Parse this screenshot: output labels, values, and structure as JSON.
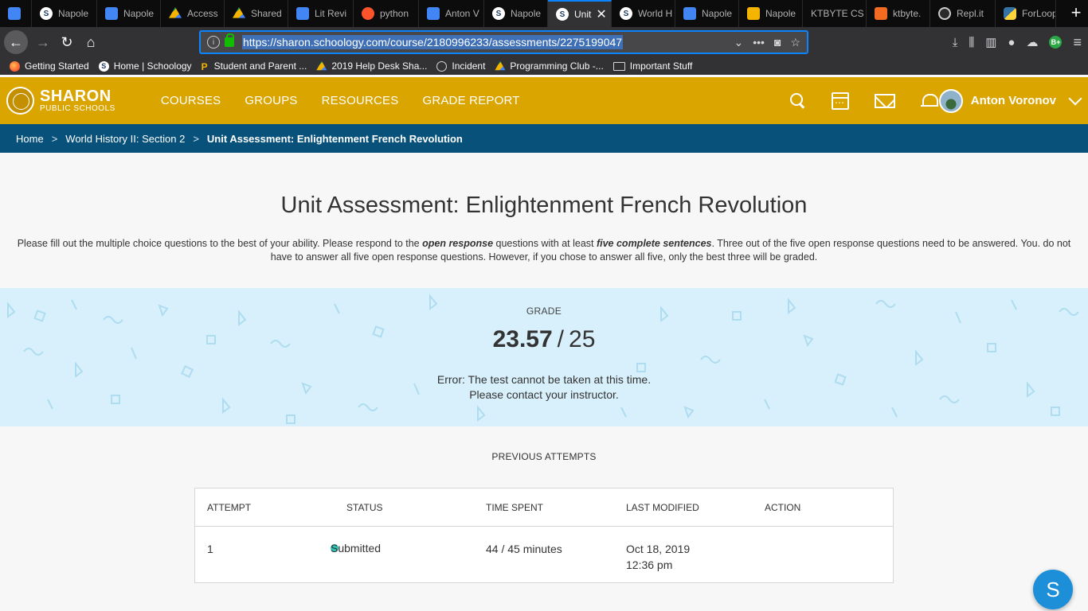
{
  "browser": {
    "tabs": [
      {
        "title": "Napole",
        "icon": "docs-icon"
      },
      {
        "title": "Napole",
        "icon": "docs-icon"
      },
      {
        "title": "Access",
        "icon": "drive-icon"
      },
      {
        "title": "Shared",
        "icon": "drive-icon"
      },
      {
        "title": "Lit Revi",
        "icon": "docs-icon"
      },
      {
        "title": "python",
        "icon": "brave-icon"
      },
      {
        "title": "Anton V",
        "icon": "docs-icon"
      },
      {
        "title": "Napole",
        "icon": "schoology-icon"
      },
      {
        "title": "Unit",
        "icon": "schoology-icon",
        "active": true
      },
      {
        "title": "World H",
        "icon": "schoology-icon"
      },
      {
        "title": "Napole",
        "icon": "docs-icon"
      },
      {
        "title": "Napole",
        "icon": "slides-icon"
      },
      {
        "title": "KTBYTE CS",
        "icon": "none"
      },
      {
        "title": "ktbyte.",
        "icon": "ktbyte-icon"
      },
      {
        "title": "Repl.it",
        "icon": "replit-icon"
      },
      {
        "title": "ForLoop",
        "icon": "python-icon"
      }
    ],
    "url": "https://sharon.schoology.com/course/2180996233/assessments/2275199047",
    "bookmarks": [
      {
        "label": "Getting Started",
        "icon": "firefox-icon"
      },
      {
        "label": "Home | Schoology",
        "icon": "schoology-icon"
      },
      {
        "label": "Student and Parent ...",
        "icon": "p-icon"
      },
      {
        "label": "2019 Help Desk Sha...",
        "icon": "drive-icon"
      },
      {
        "label": "Incident",
        "icon": "globe-icon"
      },
      {
        "label": "Programming Club -...",
        "icon": "drive-icon"
      },
      {
        "label": "Important Stuff",
        "icon": "folder-icon"
      }
    ]
  },
  "header": {
    "logo_main": "SHARON",
    "logo_sub": "PUBLIC SCHOOLS",
    "nav": [
      "COURSES",
      "GROUPS",
      "RESOURCES",
      "GRADE REPORT"
    ],
    "user_name": "Anton Voronov",
    "accent": "#dba500"
  },
  "breadcrumb": {
    "home": "Home",
    "course": "World History II: Section 2",
    "current": "Unit Assessment: Enlightenment French Revolution",
    "sep": ">"
  },
  "assessment": {
    "title": "Unit Assessment: Enlightenment French Revolution",
    "instructions": {
      "p1": "Please fill out the multiple choice questions to the best of your ability. Please respond to the ",
      "b1": "open response",
      "p2": " questions with at least ",
      "b2": "five complete sentences",
      "p3": ". Three out of the five open response questions need to be answered. You. do not have to answer all five open response questions. However, if you chose to answer all five, only the best three will be graded."
    },
    "grade_label": "GRADE",
    "score": "23.57",
    "slash": "/",
    "max": "25",
    "error_line1": "Error: The test cannot be taken at this time.",
    "error_line2": "Please contact your instructor."
  },
  "attempts": {
    "title": "PREVIOUS ATTEMPTS",
    "columns": [
      "ATTEMPT",
      "STATUS",
      "TIME SPENT",
      "LAST MODIFIED",
      "ACTION"
    ],
    "rows": [
      {
        "attempt": "1",
        "status": "Submitted",
        "time_spent": "44 / 45 minutes",
        "date": "Oct 18, 2019",
        "time": "12:36 pm",
        "action": ""
      }
    ]
  },
  "help_button": "S"
}
